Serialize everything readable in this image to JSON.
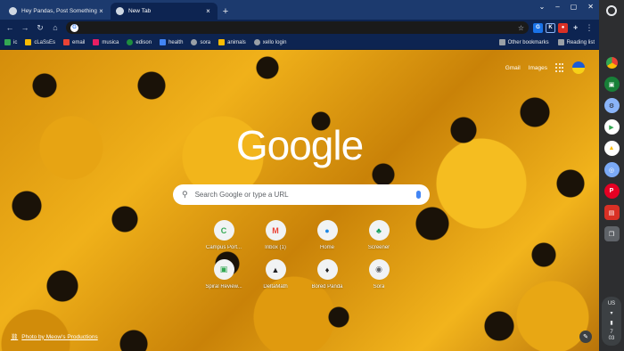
{
  "tabs": [
    {
      "title": "Hey Pandas, Post Something Th",
      "active": false
    },
    {
      "title": "New Tab",
      "active": true
    }
  ],
  "toolbar": {
    "address": "",
    "ext_icons": [
      "google-translate-icon",
      "k-icon",
      "record-icon",
      "puzzle-icon"
    ]
  },
  "bookmarks": [
    {
      "label": "ic",
      "color": "#34a853"
    },
    {
      "label": "cLaSsEs",
      "color": "#fbbc04"
    },
    {
      "label": "email",
      "color": "#ea4335"
    },
    {
      "label": "musica",
      "color": "#e91e63"
    },
    {
      "label": "edison",
      "color": "#1e8e3e"
    },
    {
      "label": "health",
      "color": "#4285f4"
    },
    {
      "label": "sora",
      "color": "#9aa0a6"
    },
    {
      "label": "animals",
      "color": "#fbbc04"
    },
    {
      "label": "xello login",
      "color": "#9aa0a6"
    }
  ],
  "bookmarks_right": {
    "other": "Other bookmarks",
    "reading": "Reading list"
  },
  "page": {
    "gmail": "Gmail",
    "images": "Images",
    "logo": "Google",
    "search_placeholder": "Search Google or type a URL",
    "credit": "Photo by Meow's Productions"
  },
  "shortcuts": [
    {
      "label": "Campus Port...",
      "glyph": "C",
      "color": "#34a853"
    },
    {
      "label": "Inbox (1)",
      "glyph": "M",
      "color": "#ea4335"
    },
    {
      "label": "Home",
      "glyph": "●",
      "color": "#1e88e5"
    },
    {
      "label": "Screener",
      "glyph": "♣",
      "color": "#0f9d58"
    },
    {
      "label": "Spiral Review...",
      "glyph": "▣",
      "color": "#34a853"
    },
    {
      "label": "DeltaMath",
      "glyph": "▲",
      "color": "#202124"
    },
    {
      "label": "Bored Panda",
      "glyph": "♦",
      "color": "#202124"
    },
    {
      "label": "Sora",
      "glyph": "◉",
      "color": "#5f6368"
    }
  ],
  "shelf_apps": [
    {
      "name": "chrome-icon",
      "color": "#ea4335"
    },
    {
      "name": "classroom-icon",
      "color": "#188038"
    },
    {
      "name": "settings-icon",
      "color": "#8ab4f8"
    },
    {
      "name": "play-store-icon",
      "color": "#34a853"
    },
    {
      "name": "drive-icon",
      "color": "#fbbc04"
    },
    {
      "name": "photo-app-icon",
      "color": "#7baaf7"
    },
    {
      "name": "pinterest-icon",
      "color": "#e60023"
    },
    {
      "name": "screencast-icon",
      "color": "#d93025"
    },
    {
      "name": "window-icon",
      "color": "#5f6368"
    }
  ],
  "tray": {
    "lang": "US",
    "time_hour": "7",
    "time_min": "03"
  }
}
